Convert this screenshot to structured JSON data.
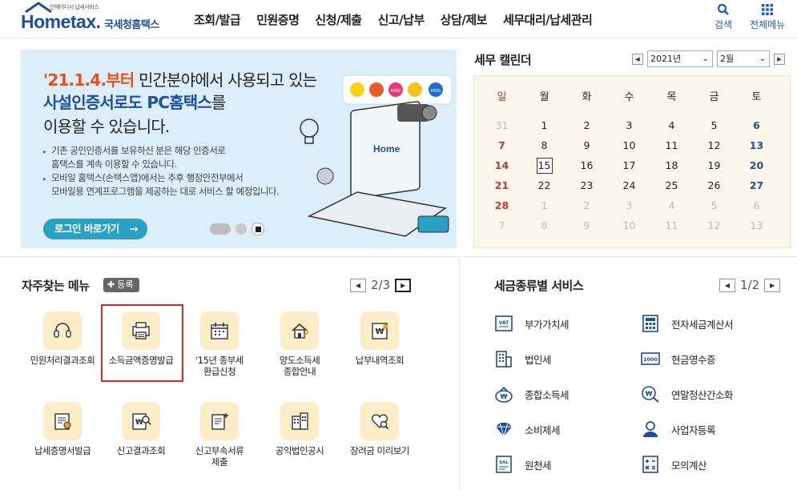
{
  "header": {
    "logo_sub": "언제어디서 납세서비스",
    "logo_main": "Hometax.",
    "logo_kr": "국세청홈택스",
    "nav": [
      "조회/발급",
      "민원증명",
      "신청/제출",
      "신고/납부",
      "상담/제보",
      "세무대리/납세관리"
    ],
    "search_label": "검색",
    "allmenu_label": "전체메뉴"
  },
  "banner": {
    "line1_highlight": "'21.1.4.부터",
    "line1_rest": " 민간분야에서 사용되고 있는",
    "line2_highlight": "사설인증서로도 PC홈택스",
    "line2_rest": "를",
    "line3": "이용할 수 있습니다.",
    "bullet1_a": "기존 공인인증서를 보유하신 분은 해당 인증서로",
    "bullet1_b": "홈택스를 계속 이용할 수 있습니다.",
    "bullet2_a": "모바일 홈택스(손택스앱)에서는 추후 행정안전부에서",
    "bullet2_b": "모바일용 연계프로그램을 제공하는 대로 서비스 할 예정입니다.",
    "login_button": "로그인 바로가기",
    "login_arrow": "→",
    "art_app_labels": [
      "PASS",
      "PASS"
    ],
    "art_screen_label": "Home"
  },
  "calendar": {
    "title": "세무 캘린더",
    "year": "2021년",
    "month": "2월",
    "weekdays": [
      "일",
      "월",
      "화",
      "수",
      "목",
      "금",
      "토"
    ],
    "weeks": [
      [
        "31",
        "1",
        "2",
        "3",
        "4",
        "5",
        "6"
      ],
      [
        "7",
        "8",
        "9",
        "10",
        "11",
        "12",
        "13"
      ],
      [
        "14",
        "15",
        "16",
        "17",
        "18",
        "19",
        "20"
      ],
      [
        "21",
        "22",
        "23",
        "24",
        "25",
        "26",
        "27"
      ],
      [
        "28",
        "1",
        "2",
        "3",
        "4",
        "5",
        "6"
      ],
      [
        "7",
        "8",
        "9",
        "10",
        "11",
        "12",
        "13"
      ]
    ],
    "today": "15"
  },
  "favorites": {
    "title": "자주찾는 메뉴",
    "register": "등록",
    "page_current": "2",
    "page_sep": "/",
    "page_total": "3",
    "items": [
      {
        "label": "민원처리결과조회",
        "icon": "headset-icon"
      },
      {
        "label": "소득금액증명발급",
        "icon": "printer-icon"
      },
      {
        "label": "'15년 종부세\n환급신청",
        "icon": "calendar-icon"
      },
      {
        "label": "양도소득세\n종합안내",
        "icon": "house-pen-icon"
      },
      {
        "label": "납부내역조회",
        "icon": "won-document-icon"
      },
      {
        "label": "납세증명서발급",
        "icon": "certificate-icon"
      },
      {
        "label": "신고결과조회",
        "icon": "won-search-icon"
      },
      {
        "label": "신고부속서류\n제출",
        "icon": "document-plus-icon"
      },
      {
        "label": "공익법인공시",
        "icon": "building-icon"
      },
      {
        "label": "장려금 미리보기",
        "icon": "heart-search-icon"
      }
    ]
  },
  "tax_services": {
    "title": "세금종류별 서비스",
    "page_current": "1",
    "page_sep": "/",
    "page_total": "2",
    "items": [
      {
        "label": "부가가치세",
        "icon": "vat-icon",
        "icon_text": "VAT"
      },
      {
        "label": "전자세금계산서",
        "icon": "calculator-sheet-icon"
      },
      {
        "label": "법인세",
        "icon": "corporate-building-icon"
      },
      {
        "label": "현금영수증",
        "icon": "receipt-icon",
        "icon_text": "1000"
      },
      {
        "label": "종합소득세",
        "icon": "money-bag-icon"
      },
      {
        "label": "연말정산간소화",
        "icon": "won-magnifier-icon"
      },
      {
        "label": "소비제세",
        "icon": "diamond-icon"
      },
      {
        "label": "사업자등록",
        "icon": "person-icon"
      },
      {
        "label": "원천세",
        "icon": "salary-sheet-icon",
        "icon_text": "SAL"
      },
      {
        "label": "모의계산",
        "icon": "calculator-icon"
      }
    ]
  }
}
